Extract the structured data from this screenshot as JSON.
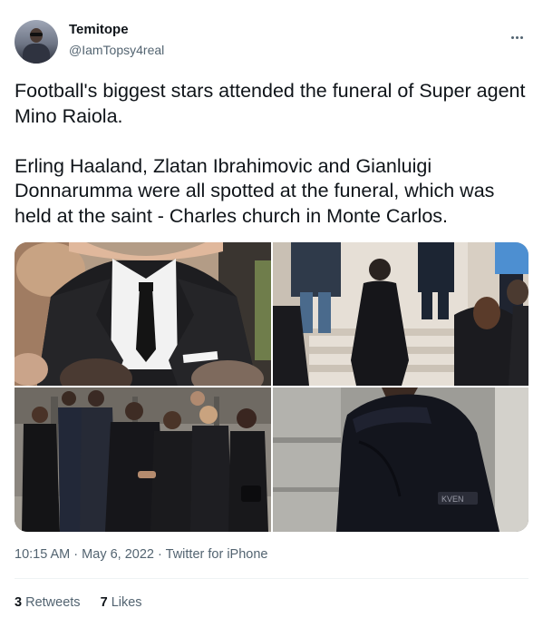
{
  "author": {
    "name": "Temitope",
    "handle": "@IamTopsy4real"
  },
  "tweet": {
    "text": "Football's biggest stars attended the funeral of Super agent Mino Raiola.\n\nErling Haaland, Zlatan Ibrahimovic and Gianluigi Donnarumma were all spotted at the funeral, which was held at the saint - Charles church in Monte Carlos."
  },
  "media": {
    "jacket_label": "KVEN"
  },
  "meta": {
    "time": "10:15 AM",
    "separator": "·",
    "date": "May 6, 2022",
    "source": "Twitter for iPhone"
  },
  "stats": {
    "retweets_count": "3",
    "retweets_label": "Retweets",
    "likes_count": "7",
    "likes_label": "Likes"
  }
}
